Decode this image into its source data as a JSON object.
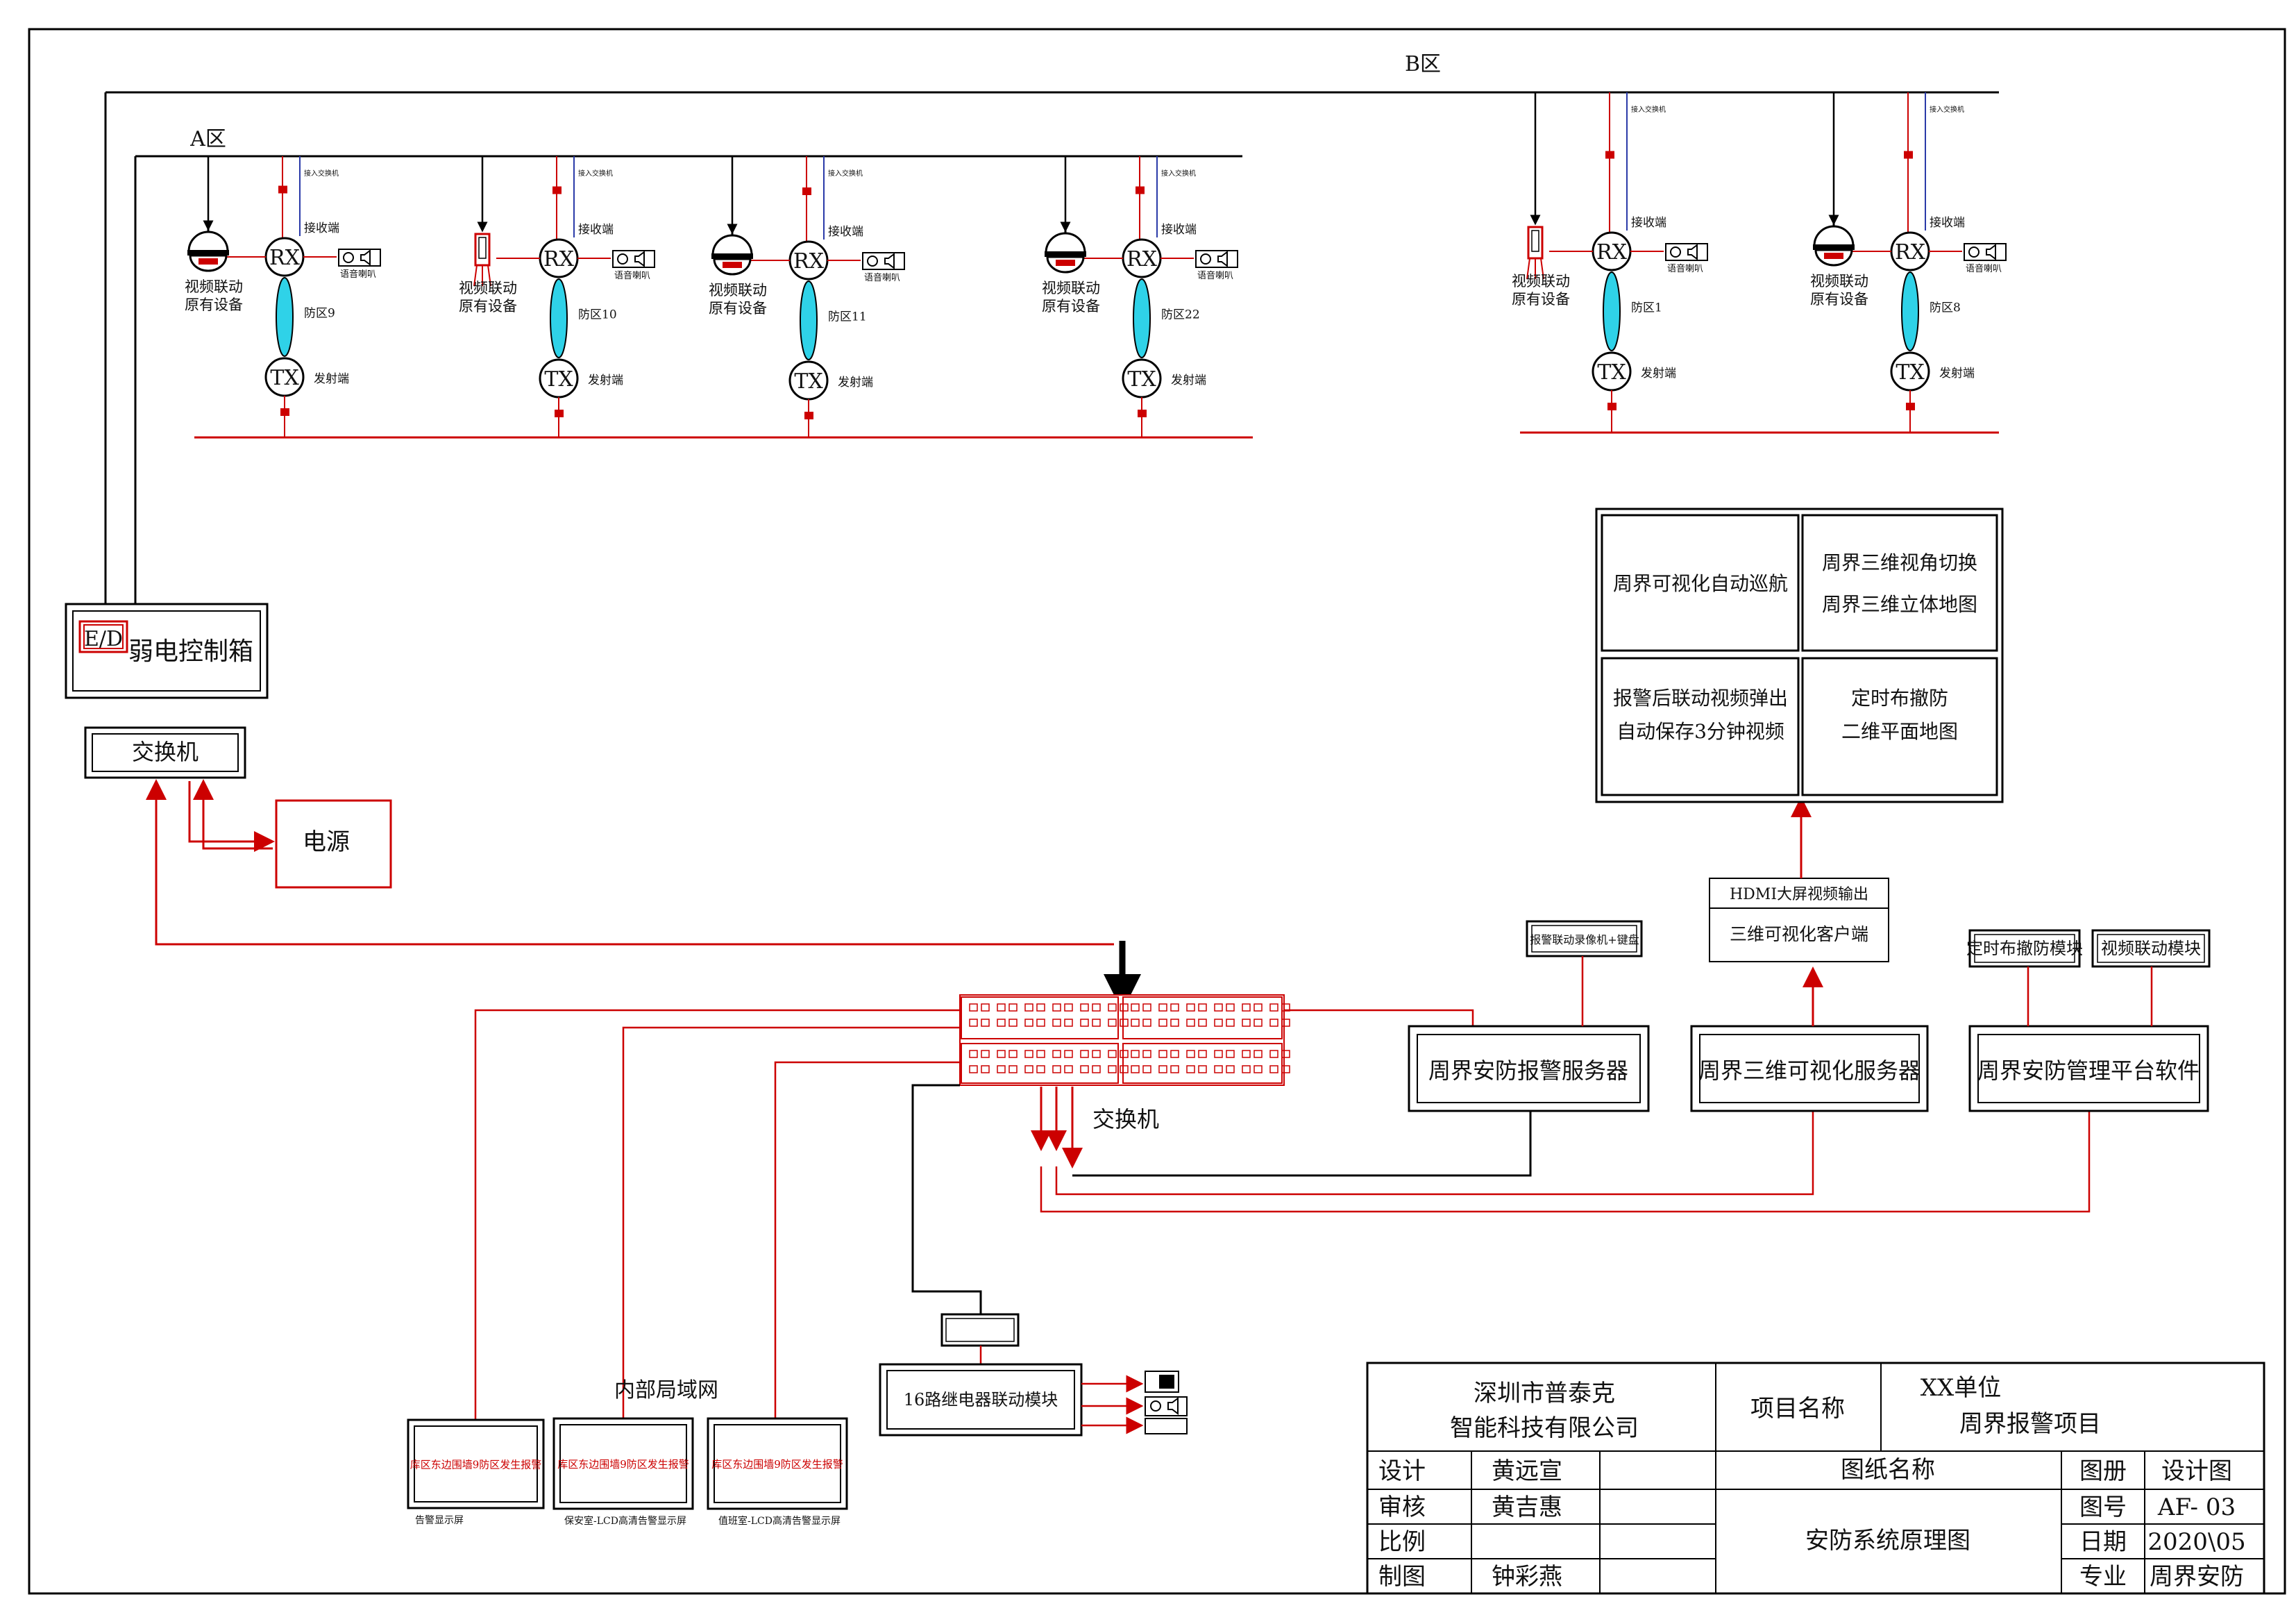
{
  "zone_b_label": "B区",
  "zone_a_label": "A区",
  "common": {
    "rx": "RX",
    "tx": "TX",
    "recv": "接收端",
    "send": "发射端",
    "switch_in": "接入交换机",
    "speaker": "语音喇叭",
    "video_line1": "视频联动",
    "video_line2": "原有设备"
  },
  "zones": [
    {
      "label": "防区9",
      "camera": "dome"
    },
    {
      "label": "防区10",
      "camera": "bullet"
    },
    {
      "label": "防区11",
      "camera": "dome"
    },
    {
      "label": "防区22",
      "camera": "dome"
    },
    {
      "label": "防区1",
      "camera": "bullet"
    },
    {
      "label": "防区8",
      "camera": "dome"
    }
  ],
  "control_box": {
    "tag": "E/D",
    "label": "弱电控制箱"
  },
  "switch_top": "交换机",
  "power": "电源",
  "video_wall": {
    "q1": "周界可视化自动巡航",
    "q2_l1": "周界三维视角切换",
    "q2_l2": "周界三维立体地图",
    "q3_l1": "报警后联动视频弹出",
    "q3_l2": "自动保存3分钟视频",
    "q4_l1": "定时布撤防",
    "q4_l2": "二维平面地图"
  },
  "client_box": {
    "l1": "HDMI大屏视频输出",
    "l2": "三维可视化客户端"
  },
  "keyboard_box": "报警联动录像机+键盘",
  "sched_module": "定时布撤防模块",
  "video_module": "视频联动模块",
  "alarm_server": "周界安防报警服务器",
  "vis_server": "周界三维可视化服务器",
  "platform": "周界安防管理平台软件",
  "core_switch": "交换机",
  "lan_label": "内部局域网",
  "relay_module": "16路继电器联动模块",
  "displays": [
    {
      "screen": "库区东边围墙9防区发生报警",
      "caption": "告警显示屏"
    },
    {
      "screen": "库区东边围墙9防区发生报警",
      "caption": "保安室-LCD高清告警显示屏"
    },
    {
      "screen": "库区东边围墙9防区发生报警",
      "caption": "值班室-LCD高清告警显示屏"
    }
  ],
  "title_block": {
    "company_l1": "深圳市普泰克",
    "company_l2": "智能科技有限公司",
    "project_label": "项目名称",
    "project_l1": "XX单位",
    "project_l2": "周界报警项目",
    "drawing_name_label": "图纸名称",
    "drawing_name": "安防系统原理图",
    "design_label": "设计",
    "design_value": "黄远宣",
    "review_label": "审核",
    "review_value": "黄吉惠",
    "scale_label": "比例",
    "scale_value": "",
    "draw_label": "制图",
    "draw_value": "钟彩燕",
    "album_label": "图册",
    "album_value": "设计图",
    "number_label": "图号",
    "number_value": "AF- 03",
    "date_label": "日期",
    "date_value": "2020\\05",
    "major_label": "专业",
    "major_value": "周界安防"
  }
}
